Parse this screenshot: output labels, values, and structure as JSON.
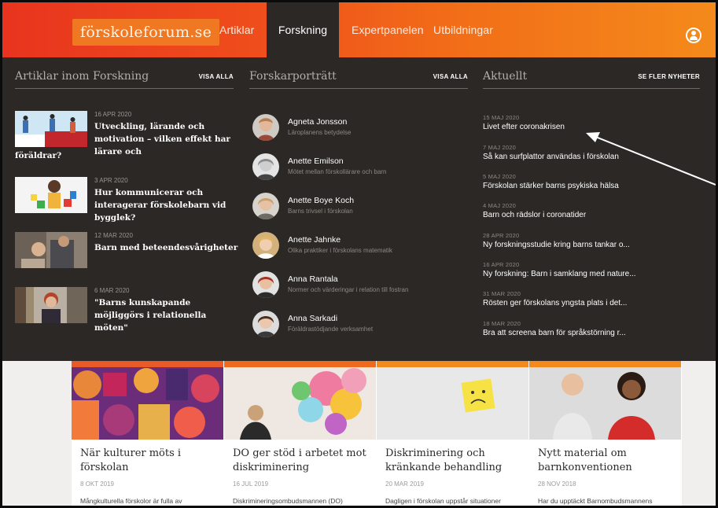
{
  "header": {
    "logo": "förskoleforum.se",
    "nav": [
      {
        "label": "Artiklar"
      },
      {
        "label": "Forskning"
      },
      {
        "label": "Expertpanelen"
      },
      {
        "label": "Utbildningar"
      }
    ],
    "active_tab": "Forskning"
  },
  "mega_menu": {
    "articles": {
      "title": "Artiklar inom Forskning",
      "link": "VISA ALLA",
      "items": [
        {
          "date": "16 APR 2020",
          "title": "Utveckling, lärande och motivation – vilken effekt har lärare och",
          "title_extra": "föräldrar?"
        },
        {
          "date": "3 APR 2020",
          "title": "Hur kommunicerar och interagerar förskolebarn vid bygglek?"
        },
        {
          "date": "12 MAR 2020",
          "title": "Barn med beteendesvårigheter"
        },
        {
          "date": "6 MAR 2020",
          "title": "\"Barns kunskapande möjliggörs i relationella möten\""
        }
      ]
    },
    "portraits": {
      "title": "Forskarporträtt",
      "link": "VISA ALLA",
      "items": [
        {
          "name": "Agneta Jonsson",
          "subtitle": "Läroplanens betydelse"
        },
        {
          "name": "Anette Emilson",
          "subtitle": "Mötet mellan förskollärare och barn"
        },
        {
          "name": "Anette Boye Koch",
          "subtitle": "Barns trivsel i förskolan"
        },
        {
          "name": "Anette Jahnke",
          "subtitle": "Olika praktiker i förskolans matematik"
        },
        {
          "name": "Anna Rantala",
          "subtitle": "Normer och värderingar i relation till fostran"
        },
        {
          "name": "Anna Sarkadi",
          "subtitle": "Föräldrastödjande verksamhet"
        }
      ]
    },
    "news": {
      "title": "Aktuellt",
      "link": "SE FLER NYHETER",
      "items": [
        {
          "date": "15 MAJ 2020",
          "title": "Livet efter coronakrisen"
        },
        {
          "date": "7 MAJ 2020",
          "title": "Så kan surfplattor användas i förskolan"
        },
        {
          "date": "5 MAJ 2020",
          "title": "Förskolan stärker barns psykiska hälsa"
        },
        {
          "date": "4 MAJ 2020",
          "title": "Barn och rädslor i coronatider"
        },
        {
          "date": "28 APR 2020",
          "title": "Ny forskningsstudie kring barns tankar o..."
        },
        {
          "date": "16 APR 2020",
          "title": "Ny forskning: Barn i samklang med nature..."
        },
        {
          "date": "31 MAR 2020",
          "title": "Rösten ger förskolans yngsta plats i det..."
        },
        {
          "date": "18 MAR 2020",
          "title": "Bra att screena barn för språkstörning r..."
        }
      ]
    }
  },
  "cards": [
    {
      "title": "När kulturer möts i förskolan",
      "date": "8 OKT 2019",
      "text": "Mångkulturella förskolor är fulla av"
    },
    {
      "title": "DO ger stöd i arbetet mot diskriminering",
      "date": "16 JUL 2019",
      "text": "Diskrimineringsombudsmannen (DO)"
    },
    {
      "title": "Diskriminering och kränkande behandling",
      "date": "20 MAR 2019",
      "text": "Dagligen i förskolan uppstår situationer"
    },
    {
      "title": "Nytt material om barnkonventionen",
      "date": "28 NOV 2018",
      "text": "Har du upptäckt Barnombudsmannens"
    }
  ],
  "colors": {
    "brand_red": "#e8341f",
    "brand_orange": "#f48a1b",
    "menu_bg": "#2b2826"
  },
  "icons": {
    "user": "user-circle-icon"
  }
}
